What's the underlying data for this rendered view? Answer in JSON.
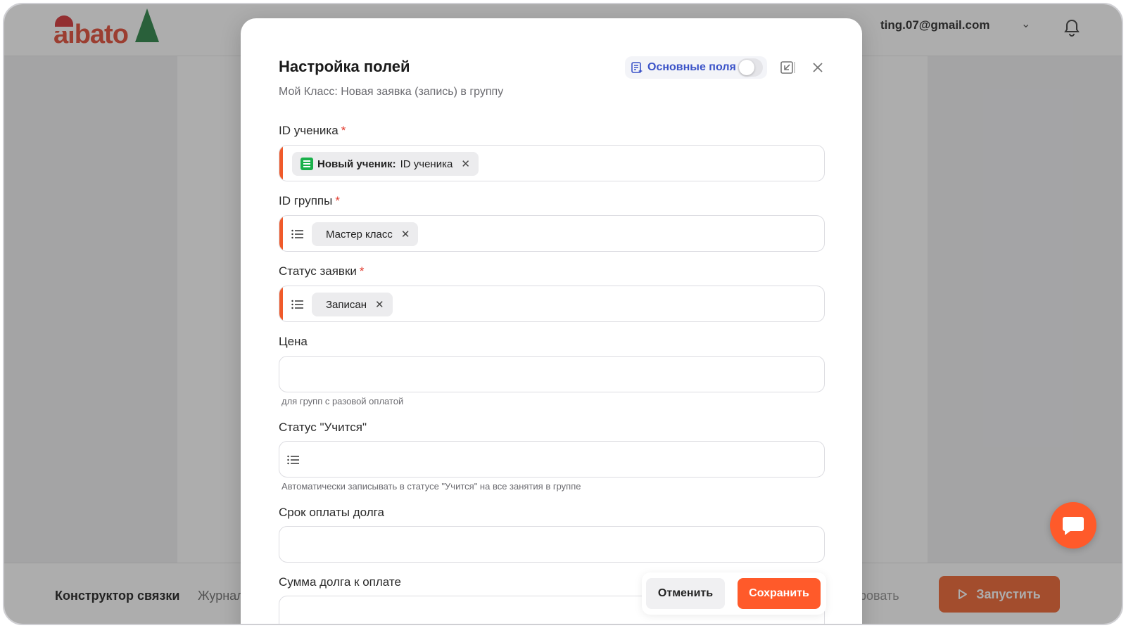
{
  "app": {
    "logo_text": "albato",
    "user_email": "ting.07@gmail.com",
    "footer_tabs": [
      "Конструктор связки",
      "Журнал"
    ],
    "footer_ghost": "ровать",
    "run_label": "Запустить"
  },
  "modal": {
    "title": "Настройка полей",
    "subtitle": "Мой Класс: Новая заявка (запись) в группу",
    "basic_fields_label": "Основные поля",
    "basic_fields_on": false,
    "fields": [
      {
        "label": "ID ученика",
        "required": true,
        "chip": {
          "source": "Новый ученик:",
          "text": "ID ученика"
        }
      },
      {
        "label": "ID группы",
        "required": true,
        "chip": {
          "text": "Мастер класс"
        }
      },
      {
        "label": "Статус заявки",
        "required": true,
        "chip": {
          "text": "Записан"
        }
      },
      {
        "label": "Цена",
        "required": false,
        "hint": "для групп с разовой оплатой"
      },
      {
        "label": "Статус \"Учится\"",
        "required": false,
        "hint": "Автоматически записывать в статусе \"Учится\" на все занятия в группе"
      },
      {
        "label": "Срок оплаты долга",
        "required": false
      },
      {
        "label": "Сумма долга к оплате",
        "required": false
      }
    ],
    "cancel_label": "Отменить",
    "save_label": "Сохранить"
  },
  "colors": {
    "accent": "#ff5a2a",
    "link": "#3b53c8",
    "required_marker": "#f05a2a",
    "moyklass_green": "#19b04a"
  },
  "icons": [
    "bell-icon",
    "chevron-down-icon",
    "list-icon",
    "close-icon",
    "expand-icon",
    "fields-icon",
    "chat-icon",
    "play-icon"
  ]
}
